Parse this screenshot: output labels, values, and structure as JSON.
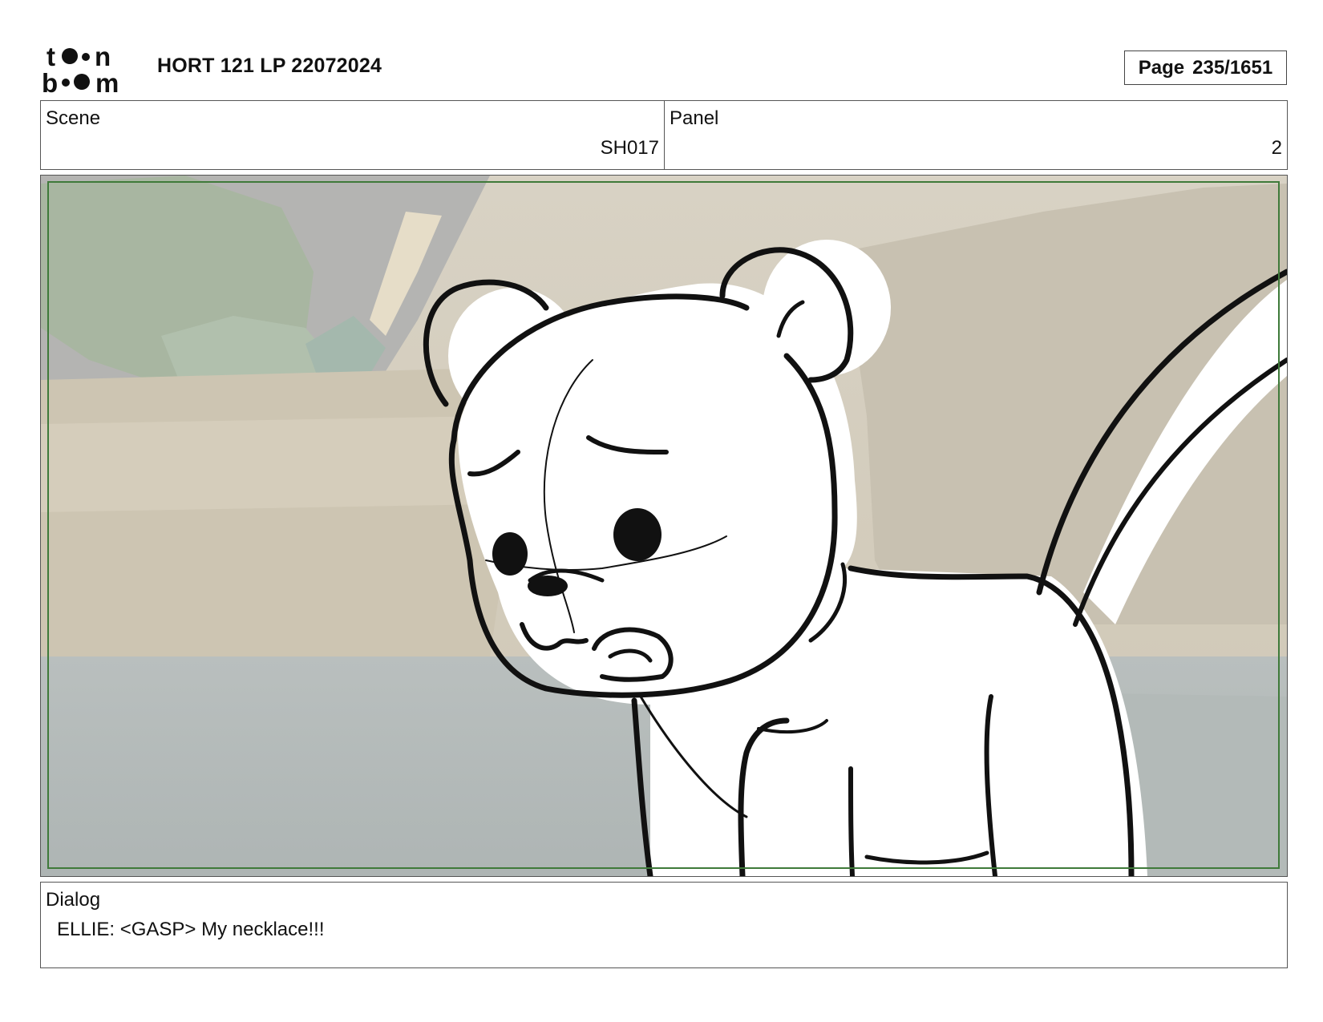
{
  "header": {
    "logo_text": "toon boom",
    "title": "HORT 121 LP 22072024",
    "page_label": "Page",
    "page_value": "235/1651"
  },
  "scene": {
    "label": "Scene",
    "value": "SH017"
  },
  "panel": {
    "label": "Panel",
    "value": "2"
  },
  "dialog": {
    "label": "Dialog",
    "text": "ELLIE: <GASP> My necklace!!!"
  },
  "colors": {
    "safe_frame": "#3f7a3a",
    "border": "#555555"
  }
}
